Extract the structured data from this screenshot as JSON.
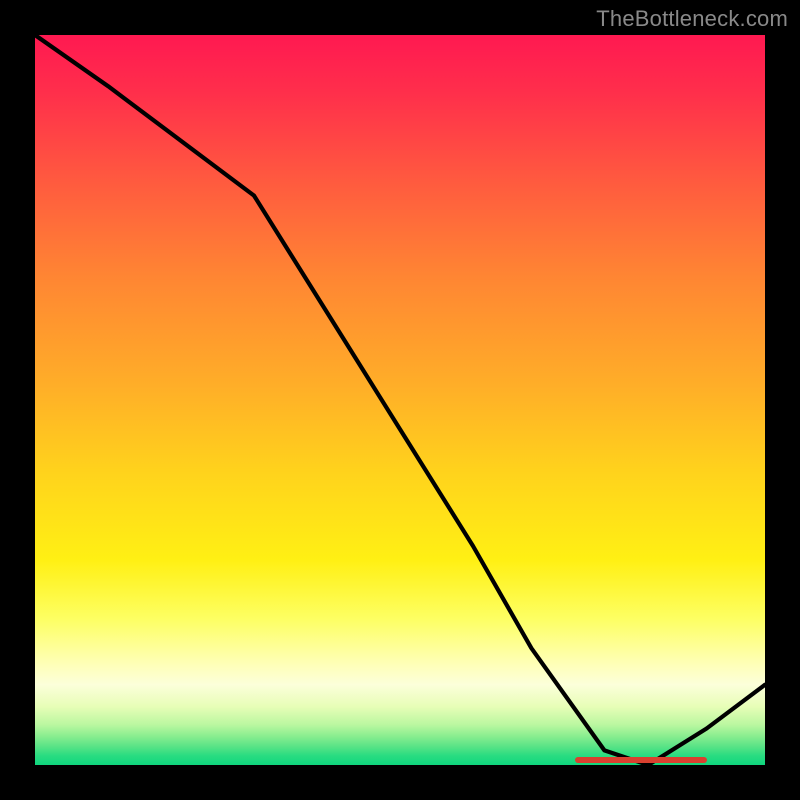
{
  "watermark": "TheBottleneck.com",
  "chart_data": {
    "type": "line",
    "title": "",
    "xlabel": "",
    "ylabel": "",
    "xlim": [
      0,
      100
    ],
    "ylim": [
      0,
      100
    ],
    "grid": false,
    "legend": false,
    "series": [
      {
        "name": "bottleneck-curve",
        "x": [
          0,
          10,
          22,
          30,
          40,
          50,
          60,
          68,
          78,
          84,
          92,
          100
        ],
        "y": [
          100,
          93,
          84,
          78,
          62,
          46,
          30,
          16,
          2,
          0,
          5,
          11
        ]
      }
    ],
    "optimal_range": {
      "start": 74,
      "end": 92,
      "color": "#d9402f"
    },
    "gradient_stops": [
      {
        "pos": 0,
        "color": "#ff1951"
      },
      {
        "pos": 20,
        "color": "#ff5a3f"
      },
      {
        "pos": 48,
        "color": "#ffae28"
      },
      {
        "pos": 72,
        "color": "#fff014"
      },
      {
        "pos": 89,
        "color": "#fcffda"
      },
      {
        "pos": 100,
        "color": "#0fd67e"
      }
    ]
  }
}
